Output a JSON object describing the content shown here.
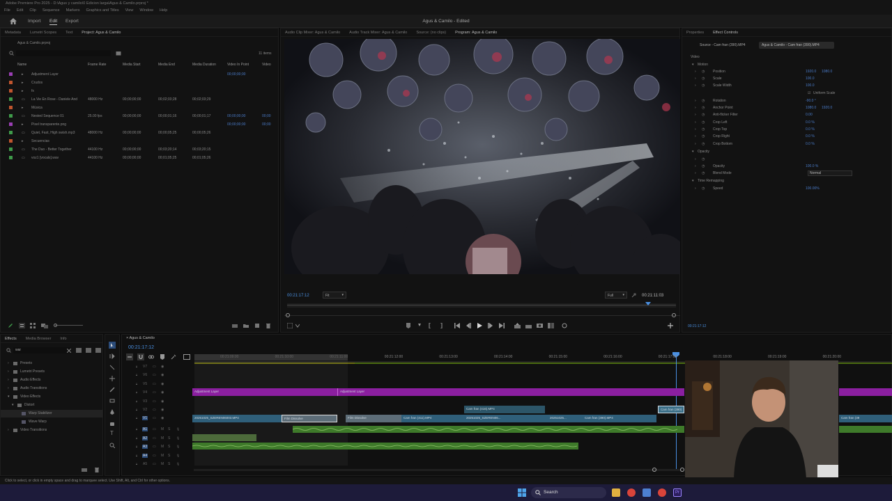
{
  "app": {
    "title_bar": "Adobe Premiere Pro 2025 - D:\\Agus y camilo\\0 Edicion larga\\Agus & Camilo.prproj *",
    "menu": [
      "File",
      "Edit",
      "Clip",
      "Sequence",
      "Markers",
      "Graphics and Titles",
      "View",
      "Window",
      "Help"
    ],
    "workspace_tabs": [
      "Import",
      "Edit",
      "Export"
    ],
    "active_workspace": "Edit",
    "document_title": "Agus & Camilo - Edited"
  },
  "project_panel": {
    "tabs": [
      "Metadata",
      "Lumetri Scopes",
      "Text",
      "Project: Agus & Camilo"
    ],
    "project_file": "Agus & Camilo.prproj",
    "item_count": "11 items",
    "columns": [
      "Name",
      "Frame Rate",
      "Media Start",
      "Media End",
      "Media Duration",
      "Video In Point",
      "Video"
    ],
    "rows": [
      {
        "name": "Adjustment Layer",
        "frame_rate": "",
        "start": "",
        "end": "",
        "duration": "",
        "in": "00;00;00;00",
        "video": "",
        "color": "#9b3fb5"
      },
      {
        "name": "Crudos",
        "frame_rate": "",
        "start": "",
        "end": "",
        "duration": "",
        "in": "",
        "video": "",
        "color": "#c0552e"
      },
      {
        "name": "fx",
        "frame_rate": "",
        "start": "",
        "end": "",
        "duration": "",
        "in": "",
        "video": "",
        "color": "#c0552e"
      },
      {
        "name": "La Vie En Rose - Daniele And",
        "frame_rate": "48000 Hz",
        "start": "00;00;00;00",
        "end": "00;02;03;28",
        "duration": "00;02;03;29",
        "in": "",
        "video": "",
        "color": "#3f9b4a"
      },
      {
        "name": "Música",
        "frame_rate": "",
        "start": "",
        "end": "",
        "duration": "",
        "in": "",
        "video": "",
        "color": "#c0552e"
      },
      {
        "name": "Nested Sequence 01",
        "frame_rate": "25.00 fps",
        "start": "00;00;00;00",
        "end": "00;00;01;16",
        "duration": "00;00;01;17",
        "in": "00;00;00;00",
        "video": "00;00",
        "color": "#3f9b4a"
      },
      {
        "name": "Pixel transparente.png",
        "frame_rate": "",
        "start": "",
        "end": "",
        "duration": "",
        "in": "00;00;00;00",
        "video": "00;00",
        "color": "#9b3fb5"
      },
      {
        "name": "Quiet, Fast, High swish.mp3",
        "frame_rate": "48000 Hz",
        "start": "00;00;00;00",
        "end": "00;00;05;25",
        "duration": "00;00;05;26",
        "in": "",
        "video": "",
        "color": "#3f9b4a"
      },
      {
        "name": "Secuencias",
        "frame_rate": "",
        "start": "",
        "end": "",
        "duration": "",
        "in": "",
        "video": "",
        "color": "#c0552e"
      },
      {
        "name": "The Duo - Better Together",
        "frame_rate": "44100 Hz",
        "start": "00;00;00;00",
        "end": "00;03;20;14",
        "duration": "00;03;20;15",
        "in": "",
        "video": "",
        "color": "#3f9b4a"
      },
      {
        "name": "voz1 [vocals].wav",
        "frame_rate": "44100 Hz",
        "start": "00;00;00;00",
        "end": "00;01;05;25",
        "duration": "00;01;05;26",
        "in": "",
        "video": "",
        "color": "#3f9b4a"
      }
    ]
  },
  "monitor": {
    "tabs": [
      "Audio Clip Mixer: Agus & Camilo",
      "Audio Track Mixer: Agus & Camilo",
      "Source: (no clips)",
      "Program: Agus & Camilo"
    ],
    "current_time": "00:21:17:12",
    "zoom": "Fit",
    "resolution": "Full",
    "duration": "00:21:11:03"
  },
  "effect_controls": {
    "tabs": [
      "Properties",
      "Effect Controls"
    ],
    "source_label": "Source - Cam fran (390).MP4",
    "clip_label": "Agus & Camilo - Cam fran (390).MP4",
    "rows": [
      {
        "label": "Video",
        "value": "",
        "value2": "",
        "indent": 0
      },
      {
        "label": "Motion",
        "value": "",
        "value2": "",
        "indent": 1
      },
      {
        "label": "Position",
        "value": "1920.0",
        "value2": "1080.0",
        "indent": 2
      },
      {
        "label": "Scale",
        "value": "100.0",
        "value2": "",
        "indent": 2
      },
      {
        "label": "Scale Width",
        "value": "100.0",
        "value2": "",
        "indent": 2
      },
      {
        "label": "Uniform Scale",
        "value": "",
        "value2": "",
        "indent": 3
      },
      {
        "label": "Rotation",
        "value": "-90.0 °",
        "value2": "",
        "indent": 2
      },
      {
        "label": "Anchor Point",
        "value": "1080.0",
        "value2": "1920.0",
        "indent": 2
      },
      {
        "label": "Anti-flicker Filter",
        "value": "0.00",
        "value2": "",
        "indent": 2
      },
      {
        "label": "Crop Left",
        "value": "0.0 %",
        "value2": "",
        "indent": 2
      },
      {
        "label": "Crop Top",
        "value": "0.0 %",
        "value2": "",
        "indent": 2
      },
      {
        "label": "Crop Right",
        "value": "0.0 %",
        "value2": "",
        "indent": 2
      },
      {
        "label": "Crop Bottom",
        "value": "0.0 %",
        "value2": "",
        "indent": 2
      },
      {
        "label": "Opacity",
        "value": "",
        "value2": "",
        "indent": 1
      },
      {
        "label": "",
        "value": "",
        "value2": "",
        "indent": 2
      },
      {
        "label": "Opacity",
        "value": "100.0 %",
        "value2": "",
        "indent": 2
      },
      {
        "label": "Blend Mode",
        "value": "Normal",
        "value2": "",
        "indent": 2
      },
      {
        "label": "Time Remapping",
        "value": "",
        "value2": "",
        "indent": 1
      },
      {
        "label": "Speed",
        "value": "100.00%",
        "value2": "",
        "indent": 2
      }
    ],
    "footer_time": "00:21:17:12"
  },
  "effects_panel": {
    "tabs": [
      "Effects",
      "Media Browser",
      "Info"
    ],
    "search_value": "war",
    "tree": [
      {
        "label": "Presets",
        "indent": 0
      },
      {
        "label": "Lumetri Presets",
        "indent": 0
      },
      {
        "label": "Audio Effects",
        "indent": 0
      },
      {
        "label": "Audio Transitions",
        "indent": 0
      },
      {
        "label": "Video Effects",
        "indent": 0
      },
      {
        "label": "Distort",
        "indent": 1
      },
      {
        "label": "Warp Stabilizer",
        "indent": 2
      },
      {
        "label": "Wave Warp",
        "indent": 2
      },
      {
        "label": "Video Transitions",
        "indent": 0
      }
    ]
  },
  "timeline": {
    "sequence_tab": "Agus & Camilo",
    "timecode": "00:21:17:12",
    "ruler": [
      "00:21:09:00",
      "00:21:10:00",
      "00:21:11:00",
      "00:21:12:00",
      "00:21:13:00",
      "00:21:14:00",
      "00:21:15:00",
      "00:21:16:00",
      "00:21:17:00",
      "00:21:18:00",
      "00:21:19:00",
      "00:21:20:00"
    ],
    "video_tracks": [
      "V7",
      "V6",
      "V5",
      "V4",
      "V3",
      "V2",
      "V1"
    ],
    "audio_tracks": [
      "A1",
      "A2",
      "A3",
      "A4",
      "A5"
    ],
    "clips": {
      "adjustment": [
        "Adjustment Layer",
        "Adjustment Layer"
      ],
      "v2": [
        "Cam fran (416).MP4",
        "Cam fran (390)"
      ],
      "v1": [
        "20251025_SZEREN06003.MP4",
        "Film Dissolve",
        "Film Dissolve",
        "Cam fran (411).MP4",
        "20251025_SZEREN06...",
        "20251025...",
        "Cam fran (390).MP4",
        "Cam fran (39"
      ]
    }
  },
  "status_bar": "Click to select, or click in empty space and drag to marquee select. Use Shift, Alt, and Ctrl for other options.",
  "taskbar": {
    "search_label": "Search"
  },
  "colors": {
    "accent_blue": "#4a90e2",
    "clip_blue": "#2f5f7a",
    "adjustment_purple": "#8b1fa0",
    "audio_green": "#3e7a2a"
  }
}
